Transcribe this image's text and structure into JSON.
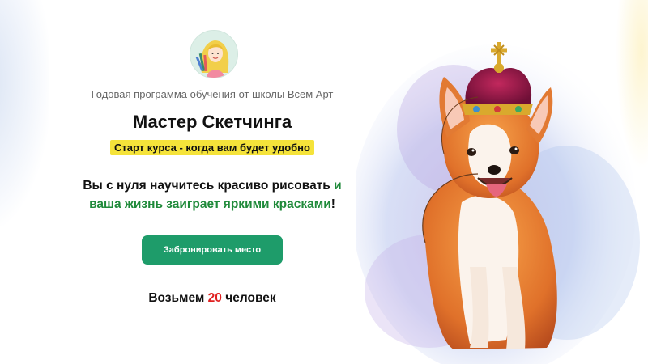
{
  "header": {
    "logo_icon": "artist-girl-logo-icon",
    "subtitle": "Годовая программа обучения от школы Всем Арт",
    "title": "Мастер Скетчинга",
    "badge": "Старт курса - когда вам будет удобно"
  },
  "lead": {
    "part1": "Вы с нуля научитесь красиво рисовать ",
    "part2": "и",
    "part3": "ваша жизнь заиграет яркими красками",
    "part4": "!"
  },
  "cta": {
    "label": "Забронировать место"
  },
  "limit": {
    "prefix": "Возьмем ",
    "number": "20",
    "suffix": " человек"
  },
  "illustration": {
    "icon": "corgi-with-crown-watercolor-icon"
  },
  "colors": {
    "accent_green": "#1e9c6a",
    "text_green": "#1f8a3a",
    "badge_yellow": "#f5e33a",
    "number_red": "#e02020"
  }
}
